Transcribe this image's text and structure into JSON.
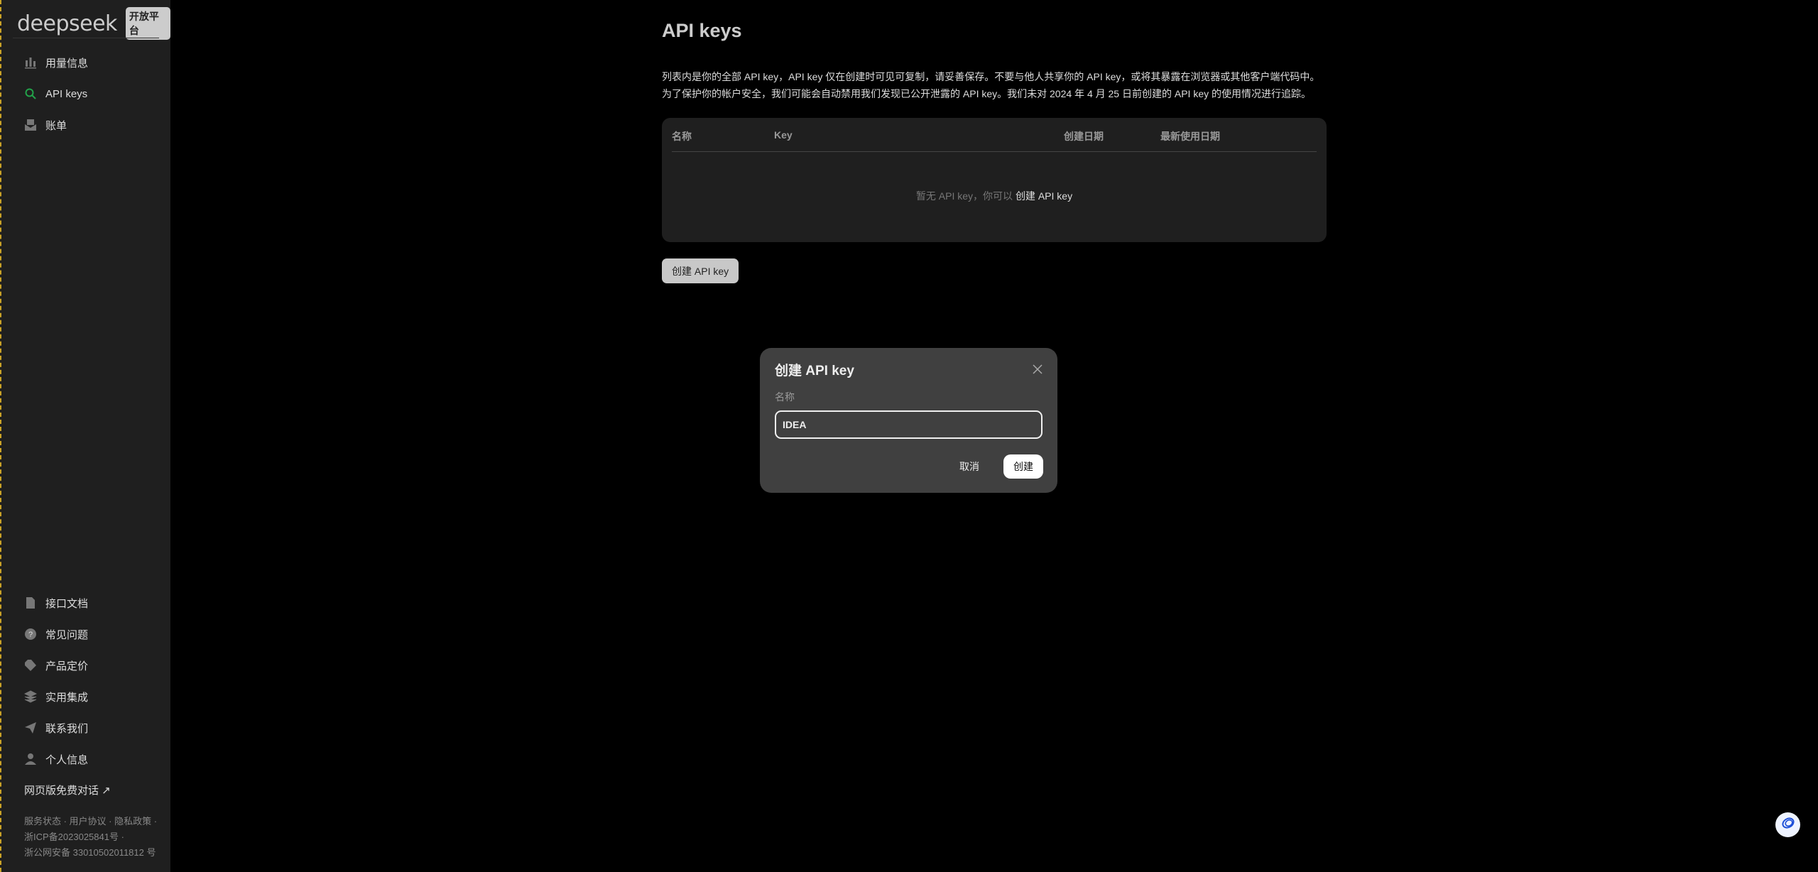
{
  "sidebar": {
    "logo": "deepseek",
    "badge": "开放平台",
    "top_items": [
      {
        "label": "用量信息",
        "icon": "bar-chart-icon"
      },
      {
        "label": "API keys",
        "icon": "search-key-icon",
        "active": true
      },
      {
        "label": "账单",
        "icon": "bill-icon"
      }
    ],
    "bottom_items": [
      {
        "label": "接口文档",
        "icon": "document-icon"
      },
      {
        "label": "常见问题",
        "icon": "question-icon"
      },
      {
        "label": "产品定价",
        "icon": "tag-icon"
      },
      {
        "label": "实用集成",
        "icon": "layers-icon"
      },
      {
        "label": "联系我们",
        "icon": "send-icon"
      },
      {
        "label": "个人信息",
        "icon": "user-icon"
      }
    ],
    "external_link": "网页版免费对话 ↗",
    "footer": [
      "服务状态 · 用户协议 · 隐私政策 ·",
      "浙ICP备2023025841号 ·",
      "浙公网安备 33010502011812 号"
    ]
  },
  "main": {
    "title": "API keys",
    "desc": [
      "列表内是你的全部 API key，API key 仅在创建时可见可复制，请妥善保存。不要与他人共享你的 API key，或将其暴露在浏览器或其他客户端代码中。",
      "为了保护你的帐户安全，我们可能会自动禁用我们发现已公开泄露的 API key。我们未对 2024 年 4 月 25 日前创建的 API key 的使用情况进行追踪。"
    ],
    "table": {
      "headers": [
        "名称",
        "Key",
        "创建日期",
        "最新使用日期"
      ],
      "empty_text": "暂无 API key，你可以 ",
      "empty_link": "创建 API key"
    },
    "create_button": "创建 API key"
  },
  "modal": {
    "title": "创建 API key",
    "label": "名称",
    "input_value": "IDEA",
    "cancel": "取消",
    "confirm": "创建"
  },
  "colors": {
    "accent": "#22a34a",
    "sidebar_bg": "#1f1f1f",
    "modal_bg": "#404040"
  }
}
